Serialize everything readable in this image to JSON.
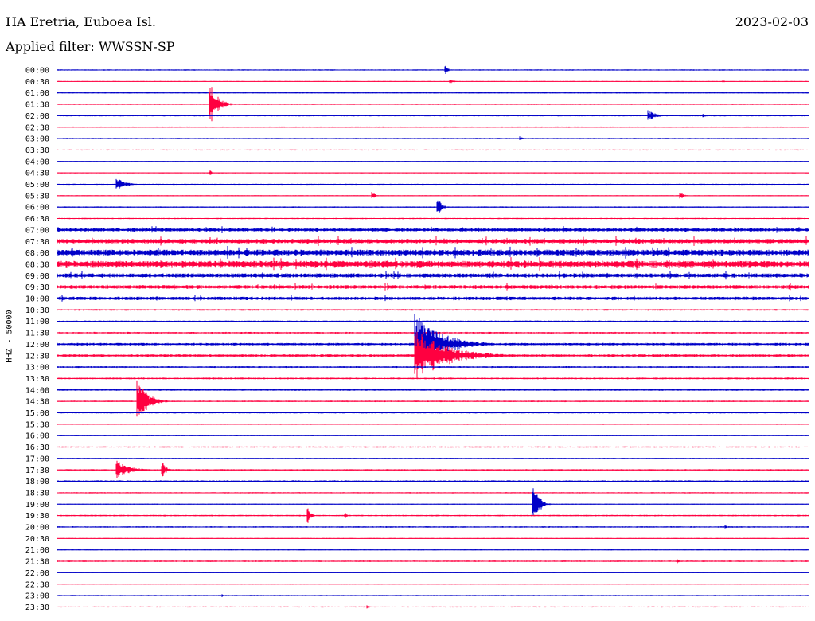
{
  "header": {
    "station": "HA Eretria, Euboea Isl.",
    "date": "2023-02-03",
    "filter": "Applied filter: WWSSN-SP"
  },
  "channel_label": "HHZ - 50000",
  "colors": {
    "odd_trace": "#0000c8",
    "even_trace": "#ff0040",
    "text": "#000000"
  },
  "chart_data": {
    "type": "seismogram",
    "trace_interval_minutes": 30,
    "minutes_per_line": 30,
    "line_start_times": [
      "00:00",
      "00:30",
      "01:00",
      "01:30",
      "02:00",
      "02:30",
      "03:00",
      "03:30",
      "04:00",
      "04:30",
      "05:00",
      "05:30",
      "06:00",
      "06:30",
      "07:00",
      "07:30",
      "08:00",
      "08:30",
      "09:00",
      "09:30",
      "10:00",
      "10:30",
      "11:00",
      "11:30",
      "12:00",
      "12:30",
      "13:00",
      "13:30",
      "14:00",
      "14:30",
      "15:00",
      "15:30",
      "16:00",
      "16:30",
      "17:00",
      "17:30",
      "18:00",
      "18:30",
      "19:00",
      "19:30",
      "20:00",
      "20:30",
      "21:00",
      "21:30",
      "22:00",
      "22:30",
      "23:00",
      "23:30"
    ],
    "trace_colors": [
      "blue",
      "red"
    ],
    "noise_levels": [
      0.6,
      0.4,
      0.6,
      0.6,
      0.7,
      0.6,
      0.6,
      0.5,
      0.5,
      0.5,
      0.5,
      0.5,
      0.6,
      0.6,
      1.6,
      2.2,
      2.8,
      3.0,
      2.0,
      1.8,
      1.6,
      0.8,
      0.8,
      0.8,
      1.2,
      1.2,
      0.8,
      0.8,
      0.8,
      0.7,
      0.7,
      0.6,
      0.6,
      0.6,
      0.6,
      0.7,
      0.9,
      0.6,
      0.5,
      0.7,
      0.7,
      0.5,
      0.5,
      0.7,
      0.4,
      0.4,
      0.6,
      0.5
    ],
    "events": [
      {
        "line": 0,
        "minute": 15.5,
        "amplitude": 6,
        "duration_min": 0.4
      },
      {
        "line": 1,
        "minute": 15.7,
        "amplitude": 3,
        "duration_min": 0.5
      },
      {
        "line": 1,
        "minute": 26.6,
        "amplitude": 2,
        "duration_min": 0.2
      },
      {
        "line": 3,
        "minute": 6.1,
        "amplitude": 30,
        "duration_min": 0.9
      },
      {
        "line": 4,
        "minute": 23.6,
        "amplitude": 8,
        "duration_min": 0.9
      },
      {
        "line": 4,
        "minute": 25.8,
        "amplitude": 3,
        "duration_min": 0.3
      },
      {
        "line": 6,
        "minute": 18.5,
        "amplitude": 3,
        "duration_min": 0.3
      },
      {
        "line": 9,
        "minute": 6.1,
        "amplitude": 4,
        "duration_min": 0.2
      },
      {
        "line": 10,
        "minute": 2.4,
        "amplitude": 8,
        "duration_min": 1.0
      },
      {
        "line": 11,
        "minute": 12.6,
        "amplitude": 6,
        "duration_min": 0.3
      },
      {
        "line": 11,
        "minute": 24.9,
        "amplitude": 5,
        "duration_min": 0.4
      },
      {
        "line": 12,
        "minute": 15.2,
        "amplitude": 12,
        "duration_min": 0.5
      },
      {
        "line": 24,
        "minute": 14.3,
        "amplitude": 40,
        "duration_min": 3.2
      },
      {
        "line": 25,
        "minute": 14.3,
        "amplitude": 35,
        "duration_min": 4.0
      },
      {
        "line": 29,
        "minute": 3.2,
        "amplitude": 30,
        "duration_min": 1.2
      },
      {
        "line": 35,
        "minute": 2.4,
        "amplitude": 12,
        "duration_min": 1.6
      },
      {
        "line": 35,
        "minute": 4.2,
        "amplitude": 10,
        "duration_min": 0.5
      },
      {
        "line": 38,
        "minute": 19.0,
        "amplitude": 28,
        "duration_min": 0.7
      },
      {
        "line": 39,
        "minute": 10.0,
        "amplitude": 10,
        "duration_min": 0.4
      },
      {
        "line": 39,
        "minute": 11.5,
        "amplitude": 4,
        "duration_min": 0.2
      },
      {
        "line": 40,
        "minute": 26.7,
        "amplitude": 3,
        "duration_min": 0.2
      },
      {
        "line": 43,
        "minute": 24.8,
        "amplitude": 3,
        "duration_min": 0.2
      },
      {
        "line": 46,
        "minute": 6.6,
        "amplitude": 2,
        "duration_min": 0.2
      },
      {
        "line": 47,
        "minute": 12.4,
        "amplitude": 3,
        "duration_min": 0.2
      }
    ]
  }
}
